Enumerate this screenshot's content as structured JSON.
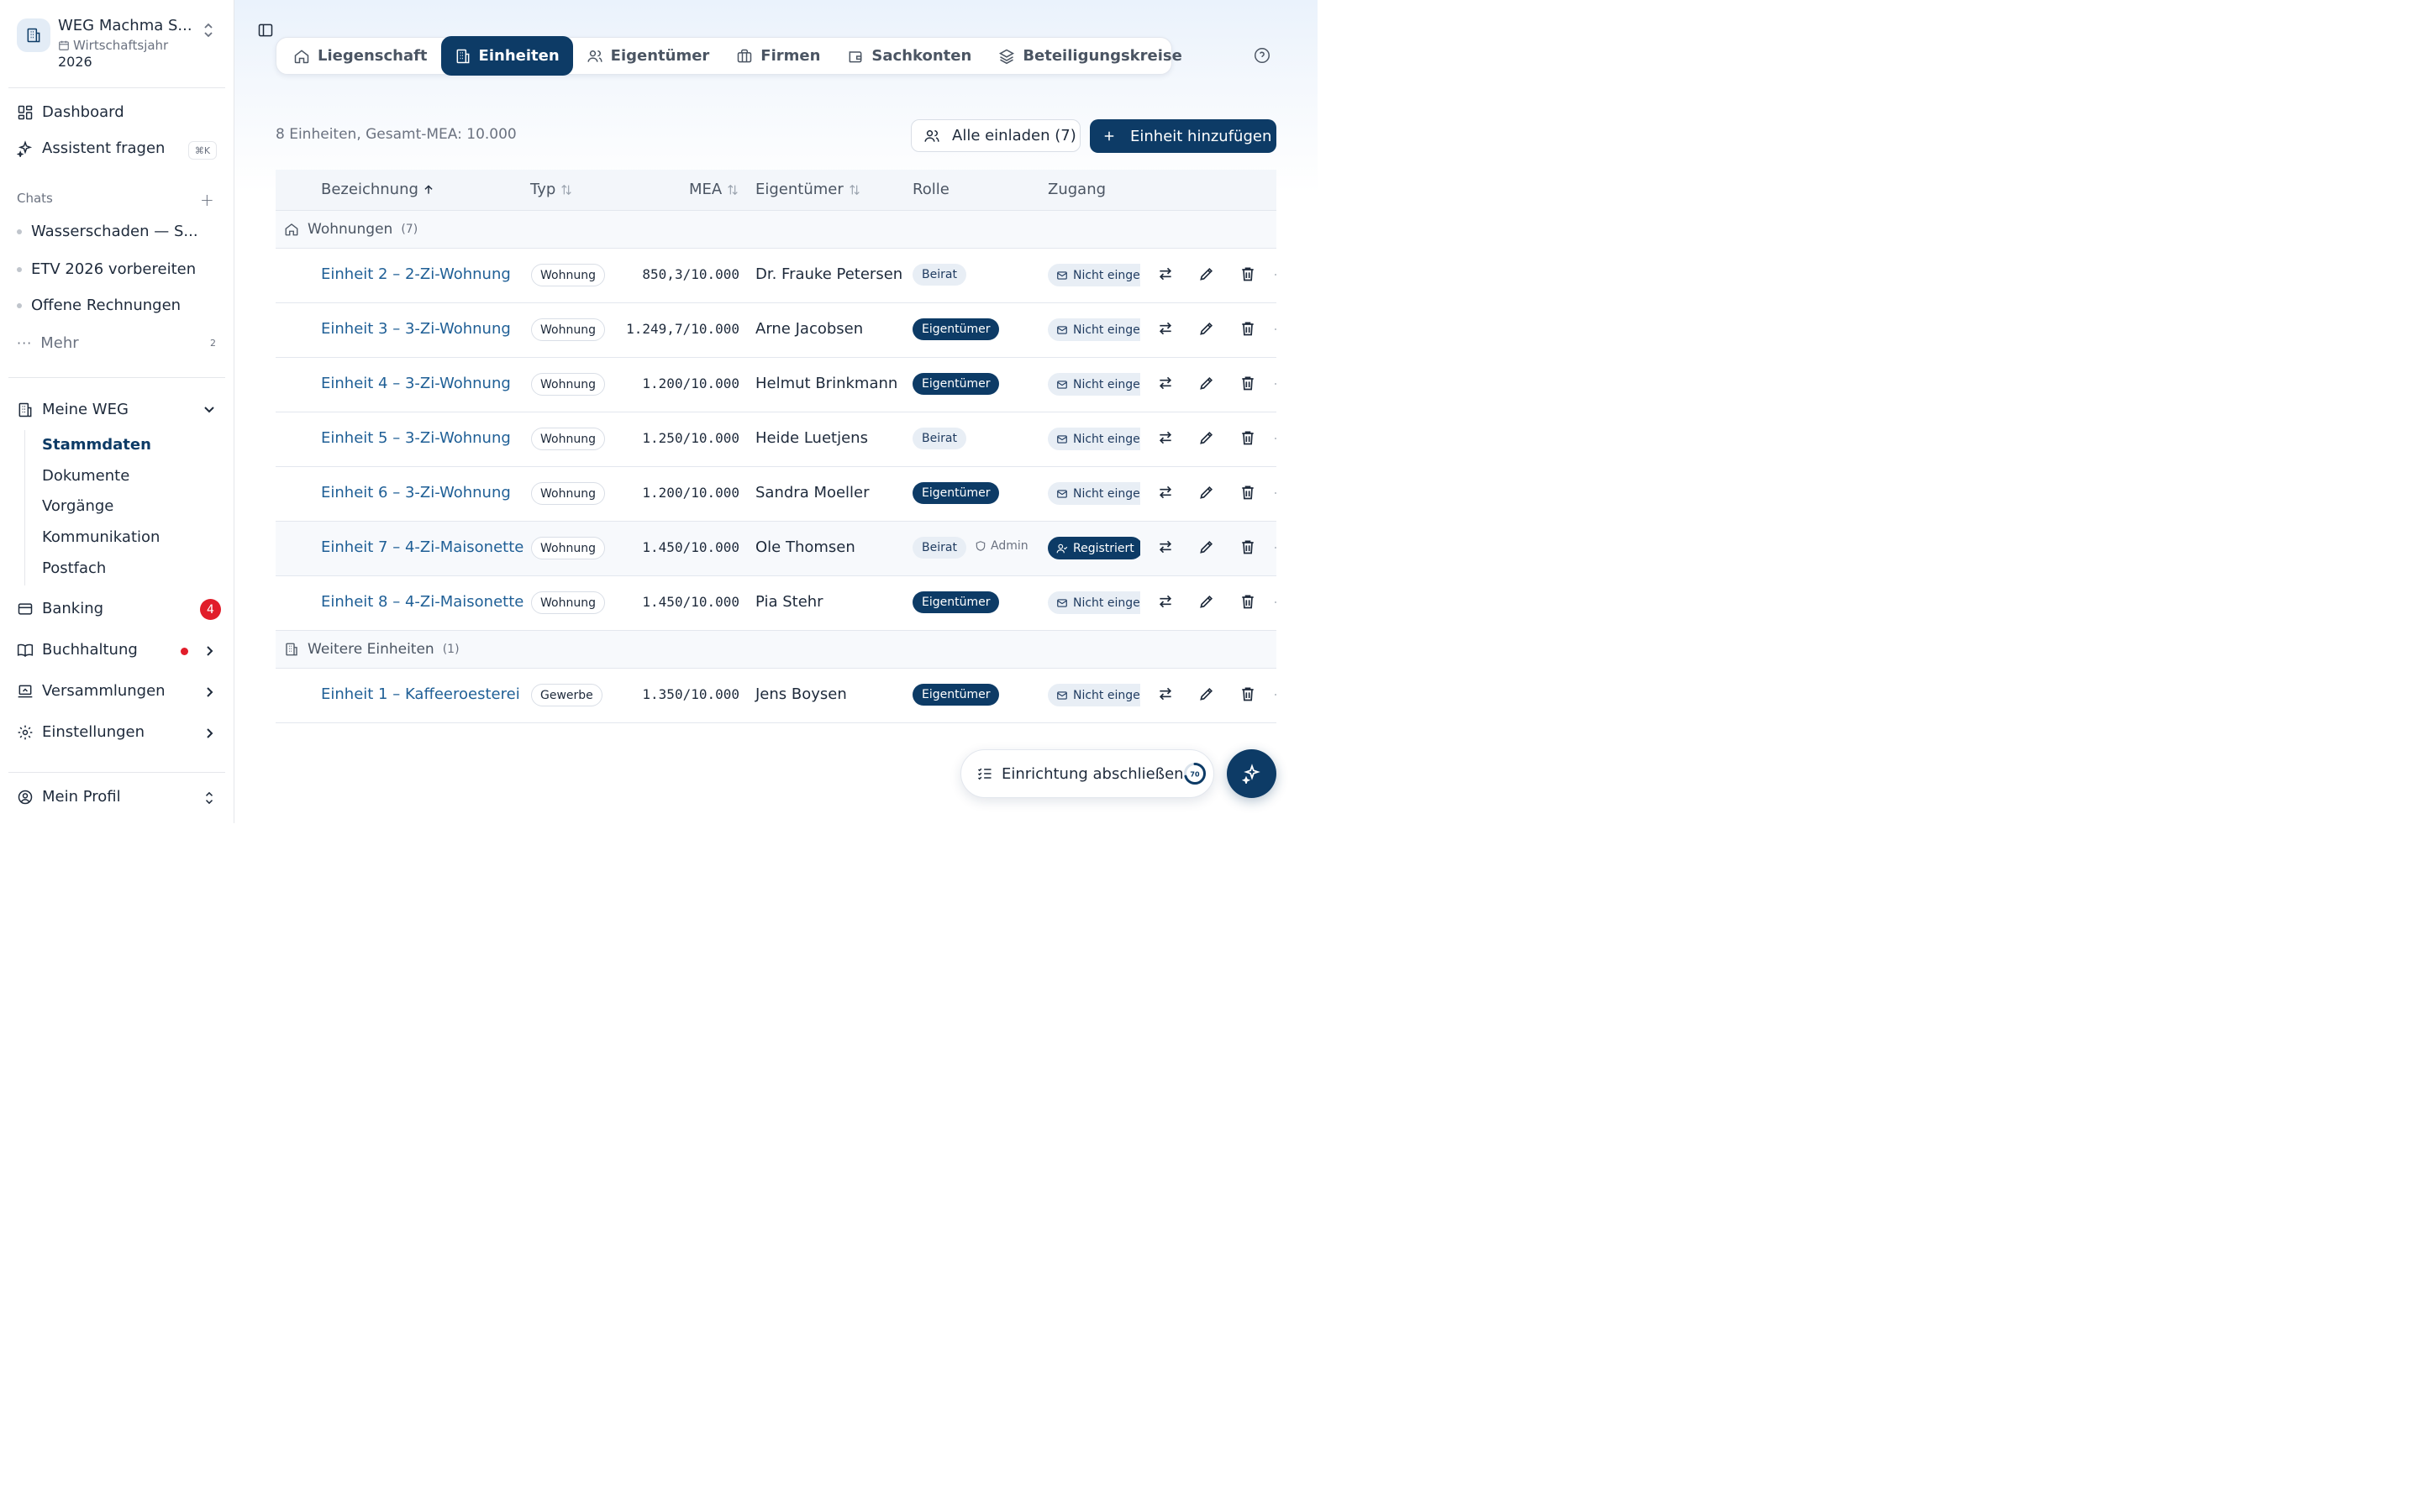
{
  "workspace": {
    "name": "WEG Machma S...",
    "sub_label": "Wirtschaftsjahr",
    "year": "2026"
  },
  "nav": {
    "dashboard": "Dashboard",
    "assistant": "Assistent fragen",
    "assistant_shortcut": "⌘K"
  },
  "chats": {
    "label": "Chats",
    "items": [
      {
        "label": "Wasserschaden — S..."
      },
      {
        "label": "ETV 2026 vorbereiten"
      },
      {
        "label": "Offene Rechnungen"
      }
    ],
    "more_label": "Mehr",
    "more_count": "2"
  },
  "meine_weg": {
    "label": "Meine WEG",
    "items": [
      {
        "label": "Stammdaten"
      },
      {
        "label": "Dokumente"
      },
      {
        "label": "Vorgänge"
      },
      {
        "label": "Kommunikation"
      },
      {
        "label": "Postfach"
      }
    ]
  },
  "banking": {
    "label": "Banking",
    "badge": "4"
  },
  "buchhaltung": {
    "label": "Buchhaltung"
  },
  "versammlungen": {
    "label": "Versammlungen"
  },
  "einstellungen": {
    "label": "Einstellungen"
  },
  "profile": {
    "label": "Mein Profil"
  },
  "tabs": [
    {
      "label": "Liegenschaft",
      "icon": "home-icon"
    },
    {
      "label": "Einheiten",
      "icon": "building-icon",
      "active": true
    },
    {
      "label": "Eigentümer",
      "icon": "users-icon"
    },
    {
      "label": "Firmen",
      "icon": "briefcase-icon"
    },
    {
      "label": "Sachkonten",
      "icon": "wallet-icon"
    },
    {
      "label": "Beteiligungskreise",
      "icon": "layers-icon"
    }
  ],
  "summary": "8 Einheiten, Gesamt-MEA: 10.000",
  "buttons": {
    "invite_all": "Alle einladen (7)",
    "add_unit": "Einheit hinzufügen"
  },
  "table": {
    "headers": {
      "name": "Bezeichnung",
      "type": "Typ",
      "mea": "MEA",
      "owner": "Eigentümer",
      "role": "Rolle",
      "access": "Zugang"
    },
    "groups": [
      {
        "label": "Wohnungen",
        "count": "(7)",
        "rows": [
          {
            "name": "Einheit 2 – 2-Zi-Wohnung",
            "type": "Wohnung",
            "mea": "850,3/10.000",
            "owner": "Dr. Frauke Petersen",
            "role": "Beirat",
            "admin": "",
            "access": "Nicht eingeladen"
          },
          {
            "name": "Einheit 3 – 3-Zi-Wohnung",
            "type": "Wohnung",
            "mea": "1.249,7/10.000",
            "owner": "Arne Jacobsen",
            "role": "Eigentümer",
            "admin": "",
            "access": "Nicht eingeladen"
          },
          {
            "name": "Einheit 4 – 3-Zi-Wohnung",
            "type": "Wohnung",
            "mea": "1.200/10.000",
            "owner": "Helmut Brinkmann",
            "role": "Eigentümer",
            "admin": "",
            "access": "Nicht eingeladen"
          },
          {
            "name": "Einheit 5 – 3-Zi-Wohnung",
            "type": "Wohnung",
            "mea": "1.250/10.000",
            "owner": "Heide Luetjens",
            "role": "Beirat",
            "admin": "",
            "access": "Nicht eingeladen"
          },
          {
            "name": "Einheit 6 – 3-Zi-Wohnung",
            "type": "Wohnung",
            "mea": "1.200/10.000",
            "owner": "Sandra Moeller",
            "role": "Eigentümer",
            "admin": "",
            "access": "Nicht eingeladen"
          },
          {
            "name": "Einheit 7 – 4-Zi-Maisonette",
            "type": "Wohnung",
            "mea": "1.450/10.000",
            "owner": "Ole Thomsen",
            "role": "Beirat",
            "admin": "Admin",
            "access": "Registriert"
          },
          {
            "name": "Einheit 8 – 4-Zi-Maisonette",
            "type": "Wohnung",
            "mea": "1.450/10.000",
            "owner": "Pia Stehr",
            "role": "Eigentümer",
            "admin": "",
            "access": "Nicht eingeladen"
          }
        ]
      },
      {
        "label": "Weitere Einheiten",
        "count": "(1)",
        "rows": [
          {
            "name": "Einheit 1 – Kaffeeroesterei",
            "type": "Gewerbe",
            "mea": "1.350/10.000",
            "owner": "Jens Boysen",
            "role": "Eigentümer",
            "admin": "",
            "access": "Nicht eingeladen"
          }
        ]
      }
    ]
  },
  "setup": {
    "label": "Einrichtung abschließen",
    "progress": 70,
    "progress_label": "70"
  },
  "colors": {
    "primary": "#0d3b66",
    "link": "#1f5f96",
    "danger": "#e11d2a"
  }
}
